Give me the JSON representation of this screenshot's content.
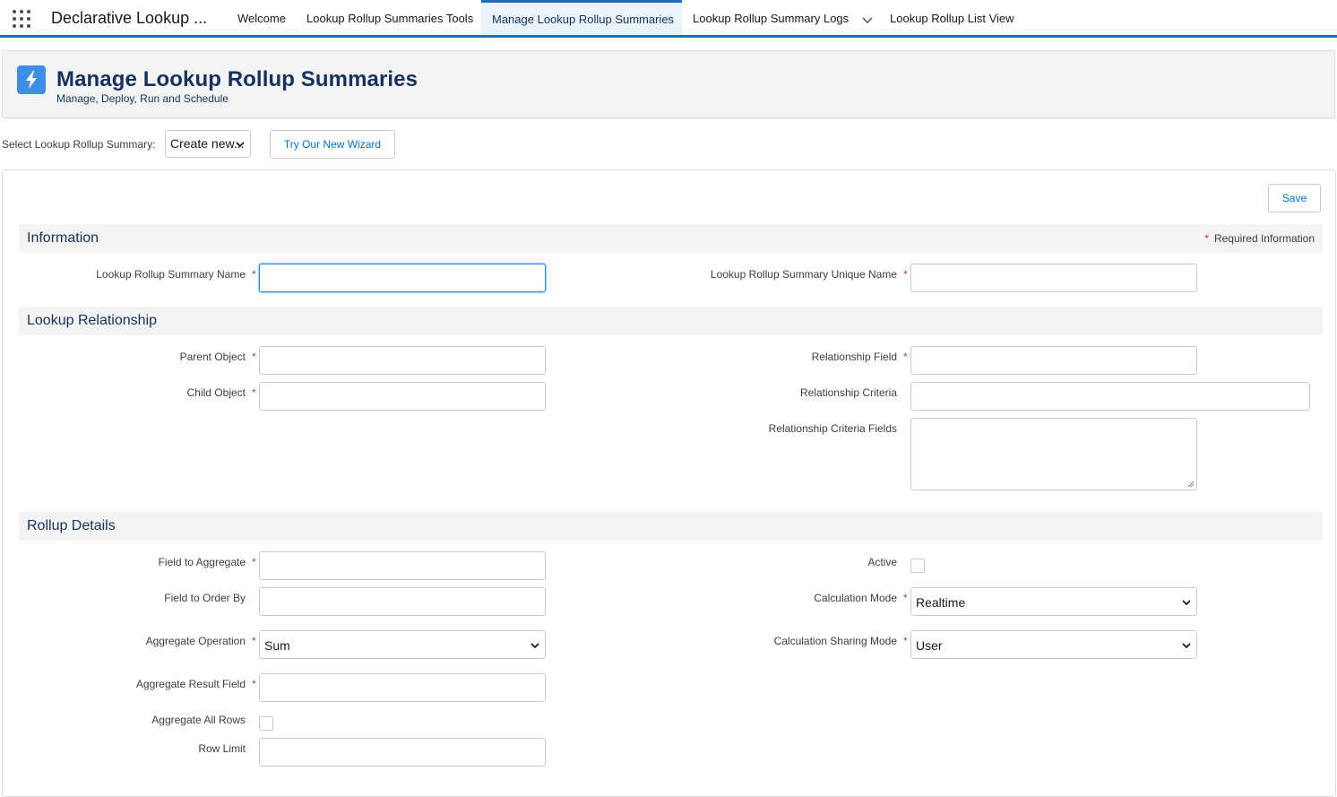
{
  "nav": {
    "app_name": "Declarative Lookup ...",
    "tabs": [
      {
        "label": "Welcome"
      },
      {
        "label": "Lookup Rollup Summaries Tools"
      },
      {
        "label": "Manage Lookup Rollup Summaries",
        "active": true
      },
      {
        "label": "Lookup Rollup Summary Logs"
      },
      {
        "label": "Lookup Rollup List View"
      }
    ]
  },
  "header": {
    "title": "Manage Lookup Rollup Summaries",
    "subtitle": "Manage, Deploy, Run and Schedule",
    "icon": "lightning-bolt-icon"
  },
  "selector": {
    "label": "Select Lookup Rollup Summary:",
    "value": "Create new...",
    "wizard_button": "Try Our New Wizard"
  },
  "form": {
    "save_label": "Save",
    "required_info": "Required Information",
    "sections": {
      "information": "Information",
      "lookup_relationship": "Lookup Relationship",
      "rollup_details": "Rollup Details"
    },
    "fields": {
      "summary_name": {
        "label": "Lookup Rollup Summary Name",
        "value": ""
      },
      "unique_name": {
        "label": "Lookup Rollup Summary Unique Name",
        "value": ""
      },
      "parent_object": {
        "label": "Parent Object",
        "value": ""
      },
      "child_object": {
        "label": "Child Object",
        "value": ""
      },
      "relationship_field": {
        "label": "Relationship Field",
        "value": ""
      },
      "relationship_criteria": {
        "label": "Relationship Criteria",
        "value": ""
      },
      "relationship_criteria_fields": {
        "label": "Relationship Criteria Fields",
        "value": ""
      },
      "field_to_aggregate": {
        "label": "Field to Aggregate",
        "value": ""
      },
      "field_to_order_by": {
        "label": "Field to Order By",
        "value": ""
      },
      "aggregate_operation": {
        "label": "Aggregate Operation",
        "value": "Sum"
      },
      "aggregate_result_field": {
        "label": "Aggregate Result Field",
        "value": ""
      },
      "aggregate_all_rows": {
        "label": "Aggregate All Rows",
        "checked": false
      },
      "row_limit": {
        "label": "Row Limit",
        "value": ""
      },
      "active": {
        "label": "Active",
        "checked": false
      },
      "calculation_mode": {
        "label": "Calculation Mode",
        "value": "Realtime"
      },
      "calculation_sharing_mode": {
        "label": "Calculation Sharing Mode",
        "value": "User"
      }
    }
  },
  "colors": {
    "accent": "#1b6ec2",
    "title": "#16325c",
    "link": "#0070d2",
    "required": "#c23934",
    "section_bg": "#f3f3f3"
  }
}
